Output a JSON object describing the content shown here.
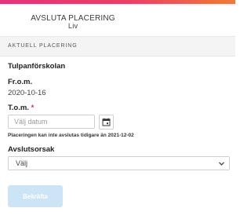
{
  "header": {
    "title": "AVSLUTA PLACERING",
    "subtitle": "Liv"
  },
  "section": {
    "label": "AKTUELL PLACERING"
  },
  "placement": {
    "name": "Tulpanförskolan",
    "from_label": "Fr.o.m.",
    "from_value": "2020-10-16",
    "to_label": "T.o.m.",
    "required_mark": "*",
    "to_placeholder": "Välj datum",
    "hint": "Placeringen kan inte avslutas tidigare än 2021-12-02"
  },
  "reason": {
    "label": "Avslutsorsak",
    "selected": "Välj"
  },
  "actions": {
    "confirm_label": "Bekräfta"
  },
  "colors": {
    "brand_gradient_start": "#e8327a",
    "brand_gradient_end": "#f07a3c",
    "required": "#d8315b",
    "button_disabled": "#cbe5f7"
  },
  "icons": {
    "calendar": "calendar-icon",
    "dropdown": "chevron-down-icon"
  }
}
